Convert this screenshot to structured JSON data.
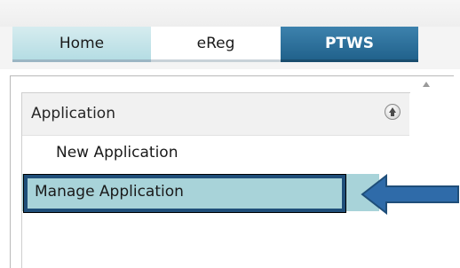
{
  "tabs": [
    {
      "label": "Home"
    },
    {
      "label": "eReg"
    },
    {
      "label": "PTWS"
    }
  ],
  "sidebar": {
    "section_title": "Application",
    "items": [
      {
        "label": "New Application"
      },
      {
        "label": "Manage Application",
        "selected": true
      }
    ]
  },
  "icons": {
    "collapse": "chevron-up-circle-icon",
    "annotation_arrow": "arrow-left-icon",
    "scroll_up": "scroll-up-icon"
  },
  "colors": {
    "active_tab": "#21628c",
    "selected_item": "#a8d3d9",
    "annotation": "#2f6ba9"
  }
}
